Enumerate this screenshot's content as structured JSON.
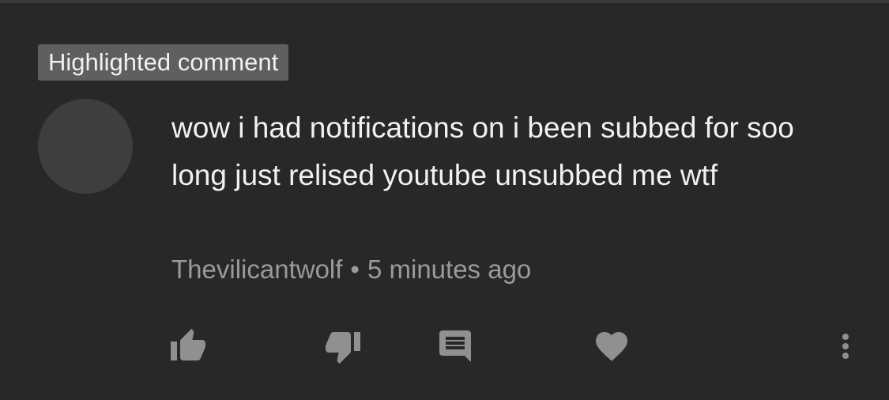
{
  "badge": {
    "label": "Highlighted comment"
  },
  "comment": {
    "text": "wow i had notifications on i been subbed for soo long just relised youtube unsubbed me wtf",
    "author": "Thevilicantwolf",
    "separator": "•",
    "timestamp": "5 minutes ago"
  },
  "actions": {
    "like_icon": "thumb-up-icon",
    "dislike_icon": "thumb-down-icon",
    "reply_icon": "comment-icon",
    "heart_icon": "heart-icon",
    "more_icon": "more-vert-icon"
  },
  "colors": {
    "background": "#282828",
    "badge_bg": "#5f5f5f",
    "text": "#f1f1f1",
    "secondary_text": "#9a9a9a",
    "icon": "#909090",
    "avatar": "#3e3e3e"
  }
}
